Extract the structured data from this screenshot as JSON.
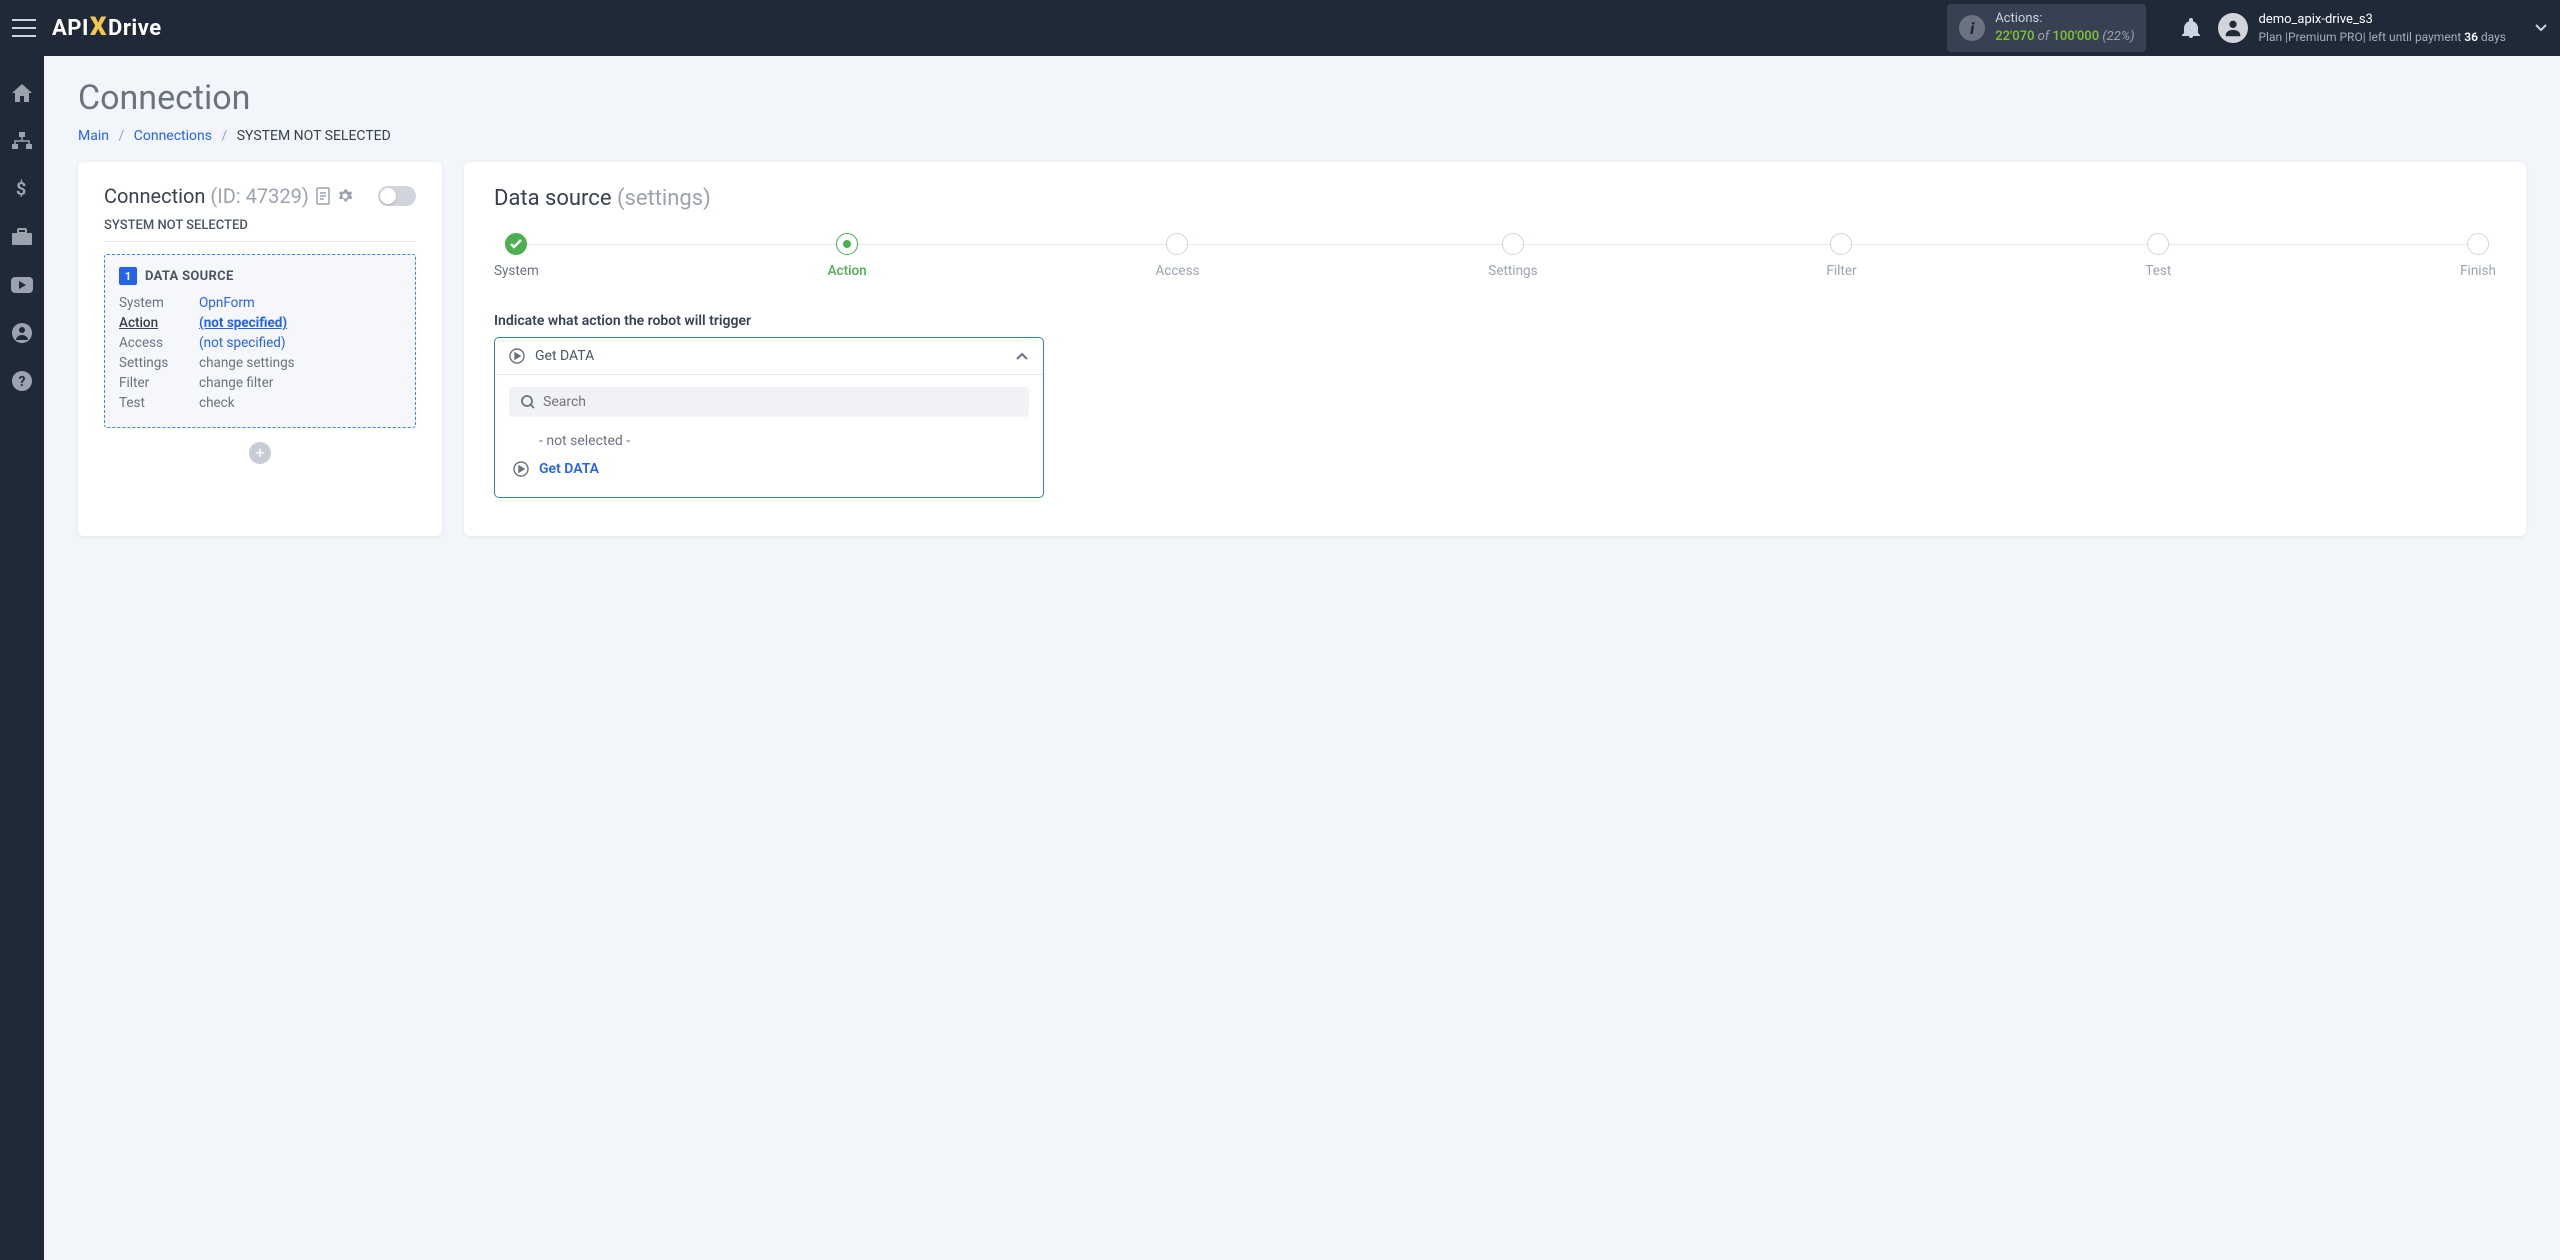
{
  "header": {
    "logo_prefix": "API",
    "logo_x": "X",
    "logo_suffix": "Drive",
    "actions_label": "Actions:",
    "actions_count": "22'070",
    "actions_of": " of ",
    "actions_total": "100'000",
    "actions_pct": " (22%)",
    "user_name": "demo_apix-drive_s3",
    "plan_prefix": "Plan  |",
    "plan_name": "Premium PRO",
    "plan_mid": "|  left until payment ",
    "plan_days": "36",
    "plan_suffix": " days"
  },
  "page": {
    "title": "Connection",
    "crumb_main": "Main",
    "crumb_conn": "Connections",
    "crumb_current": "SYSTEM NOT SELECTED"
  },
  "left": {
    "title_prefix": "Connection ",
    "title_id": "(ID: 47329)",
    "subtitle": "SYSTEM NOT SELECTED",
    "badge": "1",
    "section": "DATA SOURCE",
    "rows": {
      "system_k": "System",
      "system_v": "OpnForm",
      "action_k": "Action",
      "action_v": "(not specified)",
      "access_k": "Access",
      "access_v": "(not specified)",
      "settings_k": "Settings",
      "settings_v": "change settings",
      "filter_k": "Filter",
      "filter_v": "change filter",
      "test_k": "Test",
      "test_v": "check"
    }
  },
  "right": {
    "title": "Data source ",
    "subtitle": "(settings)",
    "steps": [
      "System",
      "Action",
      "Access",
      "Settings",
      "Filter",
      "Test",
      "Finish"
    ],
    "prompt": "Indicate what action the robot will trigger",
    "selected": "Get DATA",
    "search_placeholder": "Search",
    "opt_empty": "- not selected -",
    "opt1": "Get DATA"
  }
}
